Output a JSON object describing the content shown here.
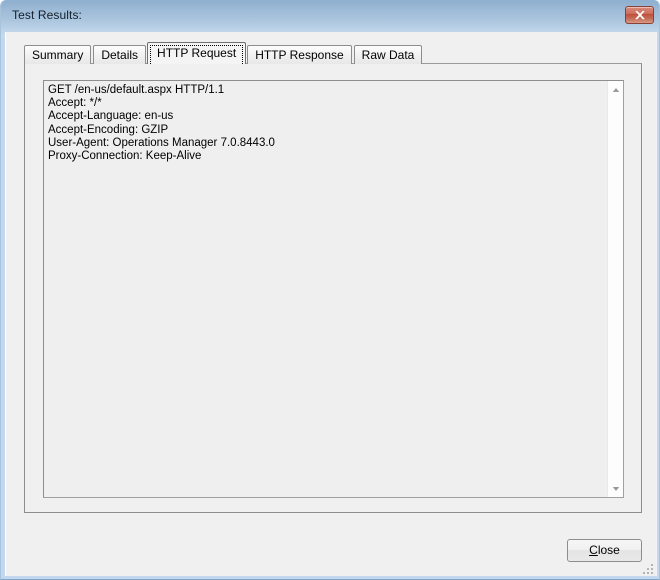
{
  "window": {
    "title": "Test Results:",
    "close_icon": "close-x-icon",
    "frame_color": "#a8c4dd",
    "titlebar_gradient_top": "#8fafcd",
    "titlebar_gradient_bottom": "#c8dbee",
    "close_button_color": "#bd4f3c"
  },
  "tabs": [
    {
      "label": "Summary",
      "selected": false
    },
    {
      "label": "Details",
      "selected": false
    },
    {
      "label": "HTTP Request",
      "selected": true
    },
    {
      "label": "HTTP Response",
      "selected": false
    },
    {
      "label": "Raw Data",
      "selected": false
    }
  ],
  "http_request": {
    "lines": [
      "GET /en-us/default.aspx HTTP/1.1",
      "Accept: */*",
      "Accept-Language: en-us",
      "Accept-Encoding: GZIP",
      "User-Agent: Operations Manager 7.0.8443.0",
      "Proxy-Connection: Keep-Alive"
    ],
    "text": "GET /en-us/default.aspx HTTP/1.1\nAccept: */*\nAccept-Language: en-us\nAccept-Encoding: GZIP\nUser-Agent: Operations Manager 7.0.8443.0\nProxy-Connection: Keep-Alive",
    "background": "#efefef",
    "readonly": true
  },
  "scrollbar": {
    "up_icon": "scroll-up-arrow-icon",
    "down_icon": "scroll-down-arrow-icon"
  },
  "footer": {
    "close_button": {
      "accel": "C",
      "rest": "lose",
      "full_label": "Close"
    },
    "resize_grip_icon": "resize-grip-icon"
  }
}
